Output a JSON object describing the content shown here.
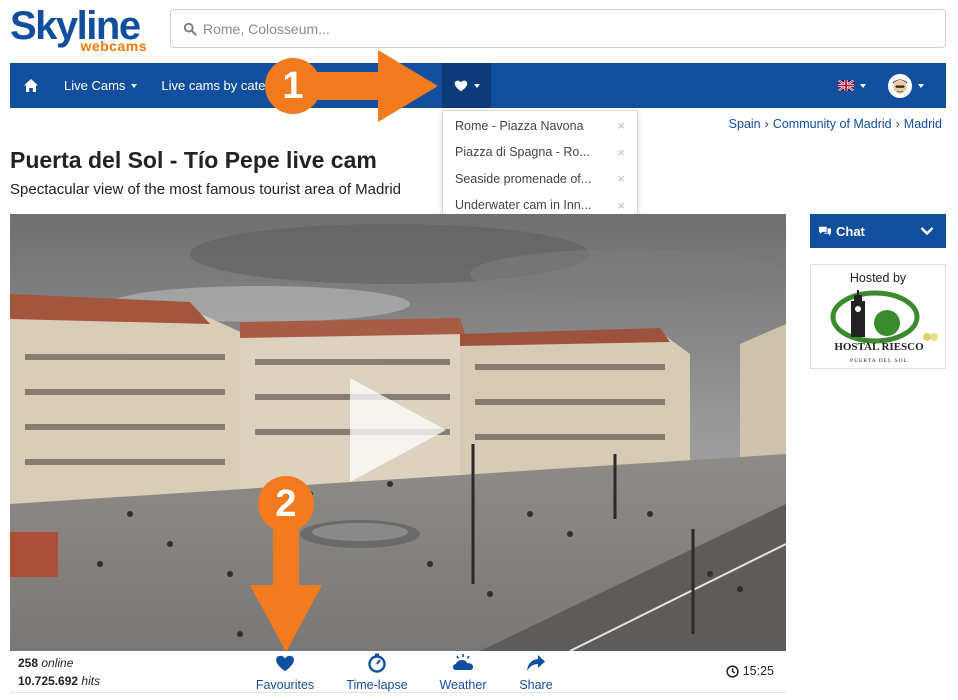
{
  "logo": {
    "main": "Skyline",
    "sub": "webcams"
  },
  "search": {
    "placeholder": "Rome, Colosseum..."
  },
  "nav": {
    "items": [
      {
        "label": "Live Cams"
      },
      {
        "label": "Live cams by categ"
      }
    ],
    "language_flag": "uk-flag-icon"
  },
  "favourites_dropdown": {
    "items": [
      {
        "label": "Rome - Piazza Navona"
      },
      {
        "label": "Piazza di Spagna - Ro..."
      },
      {
        "label": "Seaside promenade of..."
      },
      {
        "label": "Underwater cam in Inn..."
      }
    ],
    "remove_symbol": "×"
  },
  "breadcrumb": [
    "Spain",
    "Community of Madrid",
    "Madrid"
  ],
  "page": {
    "title": "Puerta del Sol - Tío Pepe live cam",
    "subtitle": "Spectacular view of the most famous tourist area of Madrid"
  },
  "stats": {
    "online_count": "258",
    "online_label": "online",
    "hits_count": "10.725.692",
    "hits_label": "hits"
  },
  "controls": [
    {
      "label": "Favourites",
      "icon": "heart-icon"
    },
    {
      "label": "Time-lapse",
      "icon": "stopwatch-icon"
    },
    {
      "label": "Weather",
      "icon": "weather-icon"
    },
    {
      "label": "Share",
      "icon": "share-arrow-icon"
    }
  ],
  "clock": {
    "time": "15:25"
  },
  "sidebar": {
    "chat_label": "Chat",
    "hosted_by": "Hosted by",
    "sponsor_name": "HOSTAL RIESCO",
    "sponsor_tagline": "PUERTA DEL SOL"
  },
  "annotations": [
    {
      "number": "1"
    },
    {
      "number": "2"
    }
  ],
  "colors": {
    "brand_blue": "#124E9E",
    "brand_orange": "#F07A00",
    "annotation_orange": "#F27B1F"
  }
}
